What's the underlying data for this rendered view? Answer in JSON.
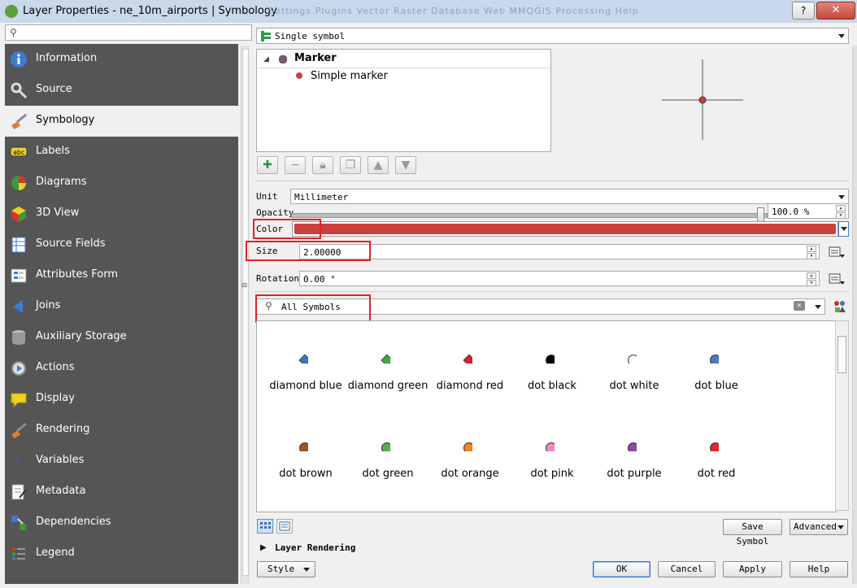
{
  "window": {
    "title": "Layer Properties - ne_10m_airports | Symbology",
    "background_menu": "Settings    Plugins    Vector    Raster    Database    Web    MMQGIS    Processing    Help",
    "help_label": "?",
    "close_label": "✕"
  },
  "sidebar": {
    "search_placeholder": "",
    "items": [
      {
        "label": "Information",
        "icon": "info-icon"
      },
      {
        "label": "Source",
        "icon": "source-wrench-icon"
      },
      {
        "label": "Symbology",
        "icon": "paintbrush-icon",
        "selected": true
      },
      {
        "label": "Labels",
        "icon": "abc-label-icon"
      },
      {
        "label": "Diagrams",
        "icon": "pie-chart-icon"
      },
      {
        "label": "3D View",
        "icon": "cube-icon"
      },
      {
        "label": "Source Fields",
        "icon": "fields-table-icon"
      },
      {
        "label": "Attributes Form",
        "icon": "form-icon"
      },
      {
        "label": "Joins",
        "icon": "join-arrow-icon"
      },
      {
        "label": "Auxiliary Storage",
        "icon": "database-icon"
      },
      {
        "label": "Actions",
        "icon": "gear-play-icon"
      },
      {
        "label": "Display",
        "icon": "speech-bubble-icon"
      },
      {
        "label": "Rendering",
        "icon": "paintbrush-icon"
      },
      {
        "label": "Variables",
        "icon": "epsilon-icon"
      },
      {
        "label": "Metadata",
        "icon": "document-pen-icon"
      },
      {
        "label": "Dependencies",
        "icon": "dependencies-icon"
      },
      {
        "label": "Legend",
        "icon": "legend-icon"
      }
    ]
  },
  "renderer": {
    "selected": "Single symbol"
  },
  "symbol_tree": {
    "root": "Marker",
    "child": "Simple marker"
  },
  "fields": {
    "unit_label": "Unit",
    "unit_value": "Millimeter",
    "opacity_label": "Opacity",
    "opacity_value": "100.0 %",
    "opacity_fraction": 1.0,
    "color_label": "Color",
    "color_value": "#c8413d",
    "size_label": "Size",
    "size_value": "2.00000",
    "rotation_label": "Rotation",
    "rotation_value": "0.00 °"
  },
  "library": {
    "search_value": "All Symbols",
    "symbols": [
      {
        "name": "diamond blue",
        "shape": "diamond",
        "color": "#3f74b8"
      },
      {
        "name": "diamond green",
        "shape": "diamond",
        "color": "#4aa444"
      },
      {
        "name": "diamond red",
        "shape": "diamond",
        "color": "#d4212b"
      },
      {
        "name": "dot  black",
        "shape": "dot",
        "color": "#000000"
      },
      {
        "name": "dot  white",
        "shape": "dot",
        "color": "#ffffff"
      },
      {
        "name": "dot blue",
        "shape": "dot",
        "color": "#4b7dc0"
      },
      {
        "name": "dot brown",
        "shape": "dot",
        "color": "#a0552a"
      },
      {
        "name": "dot green",
        "shape": "dot",
        "color": "#56ad4a"
      },
      {
        "name": "dot orange",
        "shape": "dot",
        "color": "#f0861f"
      },
      {
        "name": "dot pink",
        "shape": "dot",
        "color": "#f08ac3"
      },
      {
        "name": "dot purple",
        "shape": "dot",
        "color": "#8c4ba6"
      },
      {
        "name": "dot red",
        "shape": "dot",
        "color": "#e0282a"
      }
    ]
  },
  "buttons": {
    "save_symbol": "Save Symbol",
    "advanced": "Advanced",
    "layer_rendering": "Layer Rendering",
    "style": "Style",
    "ok": "OK",
    "cancel": "Cancel",
    "apply": "Apply",
    "help": "Help"
  },
  "colors": {
    "sidebar_bg": "#555555",
    "highlight_box": "#e02424",
    "marker_color": "#c8413d"
  }
}
